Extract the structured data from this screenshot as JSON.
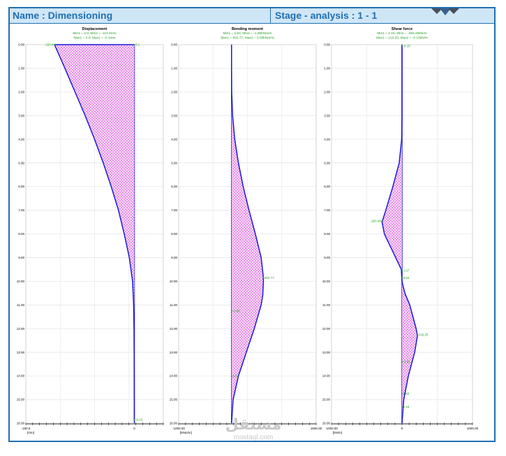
{
  "header": {
    "name": "Name : Dimensioning",
    "stage": "Stage - analysis : 1 - 1"
  },
  "colors": {
    "accent": "#1f6fb0",
    "curve": "#1a1ad6",
    "fill": "#e27ee2",
    "label": "#1e9e1e",
    "header_bg": "#cfe6f7"
  },
  "watermark": {
    "text": "مستقل",
    "sub": "mostaql.com"
  },
  "chart_data": [
    {
      "type": "line",
      "title": "Displacement",
      "subtitle_lines": [
        "Min1 = 0.0; Min2 = -110.4mm",
        "Max1 = 0.0; Max2 = -0.1mm"
      ],
      "unit": "[mm]",
      "ylim": [
        0,
        16
      ],
      "yticks": [
        "0.00",
        "1.00",
        "2.00",
        "3.00",
        "4.00",
        "5.00",
        "6.00",
        "7.00",
        "8.00",
        "9.00",
        "10.00",
        "11.00",
        "12.00",
        "13.00",
        "14.00",
        "15.00",
        "16.00"
      ],
      "xlim": [
        -150,
        40
      ],
      "xticks": [
        {
          "v": -150,
          "label": "-150.0"
        },
        {
          "v": 0,
          "label": "0"
        }
      ],
      "depth": [
        0,
        1,
        2,
        3,
        4,
        5,
        6,
        7,
        8,
        9,
        10,
        11,
        12,
        13,
        14,
        15,
        15.9
      ],
      "values": [
        -110.4,
        -96,
        -82,
        -68,
        -55,
        -43,
        -32,
        -22,
        -14,
        -7,
        -2.5,
        -1,
        -0.5,
        -0.3,
        -0.2,
        -0.1,
        -0.1
      ],
      "data_labels": [
        {
          "x": -110.4,
          "y": 0,
          "text": "-110.4"
        },
        {
          "x": 0,
          "y": 0,
          "text": "0.1"
        },
        {
          "x": 0,
          "y": 15.85,
          "text": "-0.13"
        }
      ],
      "grid": true
    },
    {
      "type": "line",
      "title": "Bending moment",
      "subtitle_lines": [
        "Min1 = 2.54; Min2 = -1.95kNm/m",
        "Max1 = 602.77; Max2 = 0.00kNm/m"
      ],
      "unit": "[kNm/m]",
      "ylim": [
        0,
        16
      ],
      "yticks": [
        "0.00",
        "1.00",
        "2.00",
        "3.00",
        "4.00",
        "5.00",
        "6.00",
        "7.00",
        "8.00",
        "9.00",
        "10.00",
        "11.00",
        "12.00",
        "13.00",
        "14.00",
        "15.00",
        "16.00"
      ],
      "xlim": [
        -1000,
        1600
      ],
      "xticks": [
        {
          "v": -1000,
          "label": "-1000.00"
        },
        {
          "v": 1600,
          "label": "1600.00"
        }
      ],
      "depth": [
        0,
        1,
        2,
        3,
        4,
        5,
        6,
        7,
        8,
        9,
        9.8,
        10,
        10.6,
        11,
        12,
        13,
        14,
        15,
        16
      ],
      "values": [
        0,
        0,
        2.54,
        20,
        60,
        130,
        220,
        330,
        450,
        560,
        600,
        602.77,
        590,
        560,
        430,
        280,
        130,
        30,
        0
      ],
      "data_labels": [
        {
          "x": 602.77,
          "y": 9.85,
          "text": "602.77"
        },
        {
          "x": 0,
          "y": 11.25,
          "text": "-1.95"
        },
        {
          "x": 0,
          "y": 14.0,
          "text": "2.54"
        }
      ],
      "grid": true
    },
    {
      "type": "line",
      "title": "Shear force",
      "subtitle_lines": [
        "Min1 = 2.16; Min2 = -283.48kN/m",
        "Max1 = 219.25; Max2 = -0.15kN/m"
      ],
      "unit": "[kN/m]",
      "ylim": [
        0,
        16
      ],
      "yticks": [
        "0.00",
        "1.00",
        "2.00",
        "3.00",
        "4.00",
        "5.00",
        "6.00",
        "7.00",
        "8.00",
        "9.00",
        "10.00",
        "11.00",
        "12.00",
        "13.00",
        "14.00",
        "15.00",
        "16.00"
      ],
      "xlim": [
        -1000,
        1000
      ],
      "xticks": [
        {
          "v": -1000,
          "label": "-1000.00"
        },
        {
          "v": 0,
          "label": "0"
        },
        {
          "v": 1000,
          "label": "1000.00"
        }
      ],
      "depth": [
        0,
        3,
        4,
        5,
        6,
        7,
        7.5,
        8,
        9,
        9.5,
        10,
        10.5,
        11,
        12,
        12.3,
        13,
        14,
        15,
        16
      ],
      "values": [
        0,
        0,
        -5,
        -40,
        -130,
        -230,
        -283.48,
        -250,
        -90,
        -10,
        0,
        40,
        110,
        200,
        219.25,
        180,
        90,
        25,
        0
      ],
      "data_labels": [
        {
          "x": 0,
          "y": 0.05,
          "text": "-0.15"
        },
        {
          "x": -283.48,
          "y": 7.45,
          "text": "-283.48"
        },
        {
          "x": 0,
          "y": 9.55,
          "text": "2.57"
        },
        {
          "x": 0,
          "y": 9.85,
          "text": "8.54"
        },
        {
          "x": 219.25,
          "y": 12.25,
          "text": "219.25"
        },
        {
          "x": 0,
          "y": 13.4,
          "text": "-2.85"
        },
        {
          "x": 0,
          "y": 14.75,
          "text": "1.52"
        },
        {
          "x": 0,
          "y": 15.3,
          "text": "2.16"
        }
      ],
      "grid": true
    }
  ]
}
